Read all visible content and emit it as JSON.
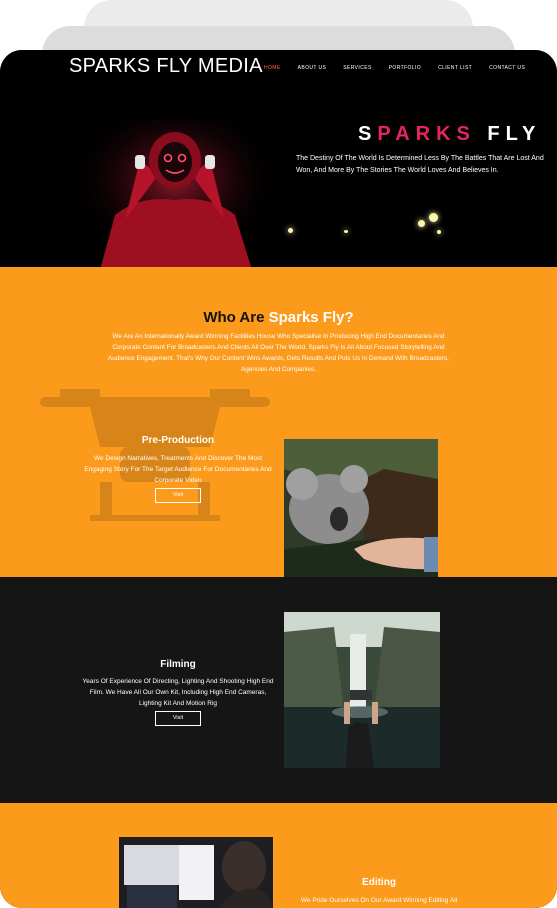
{
  "header": {
    "brand": "SPARKS FLY MEDIA",
    "nav": [
      {
        "label": "HOME",
        "active": true
      },
      {
        "label": "ABOUT US",
        "active": false
      },
      {
        "label": "SERVICES",
        "active": false
      },
      {
        "label": "PORTFOLIO",
        "active": false
      },
      {
        "label": "CLIENT LIST",
        "active": false
      },
      {
        "label": "CONTACT US",
        "active": false
      }
    ]
  },
  "hero": {
    "title_a": "S",
    "title_b": "PARKS",
    "title_c": " FLY",
    "subtitle": "The Destiny Of The World Is Determined Less By The Battles That Are Lost And Won, And More By The Stories The World Loves And Believes In."
  },
  "about": {
    "heading_prefix": "Who Are ",
    "heading_highlight": "Sparks Fly?",
    "paragraph": "We Are An Internationally Award Winning Facilities House Who Specialise In Producing High End Documentaries And Corporate Content For Broadcasters And Clients All Over The World. Sparks Fly Is All About Focused Storytelling And Audience Engagement. That's Why Our Content Wins Awards, Gets Results And Puts Us In Demand With Broadcasters, Agencies And Companies."
  },
  "services": [
    {
      "title": "Pre-Production",
      "description": "We Design Narratives, Treatments And Discover The Most Engaging Story For The Target Audience For Documentaries And Corporate Video",
      "button": "Visit"
    },
    {
      "title": "Filming",
      "description": "Years Of Experience Of Directing, Lighting And Shooting High End Film. We Have All Our Own Kit, Including High End Cameras, Lighting Kit And Motion Rig",
      "button": "Visit"
    },
    {
      "title": "Editing",
      "description": "We Pride Ourselves On Our Award Winning Editing All"
    }
  ],
  "colors": {
    "accent_orange": "#fb9a1b",
    "title_pink": "#e8245f",
    "nav_active": "#ff6a2a",
    "dark_bg": "#151515"
  }
}
